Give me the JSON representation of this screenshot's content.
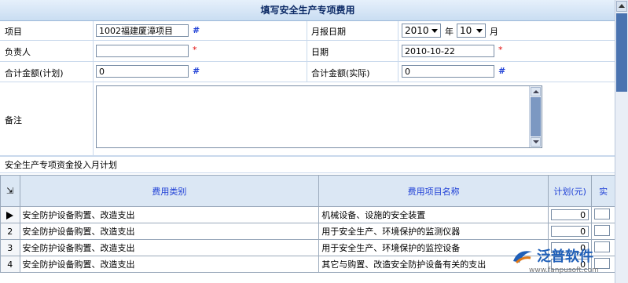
{
  "form": {
    "title": "填写安全生产专项费用",
    "project_label": "项目",
    "project_value": "1002福建厦漳项目",
    "month_label": "月报日期",
    "year_value": "2010",
    "year_unit": "年",
    "month_value": "10",
    "month_unit": "月",
    "owner_label": "负责人",
    "owner_value": "",
    "date_label": "日期",
    "date_value": "2010-10-22",
    "plan_total_label": "合计金额(计划)",
    "plan_total_value": "0",
    "actual_total_label": "合计金额(实际)",
    "actual_total_value": "0",
    "note_label": "备注",
    "note_value": "",
    "hash_mark": "#",
    "required_mark": "*"
  },
  "section": {
    "title": "安全生产专项资金投入月计划"
  },
  "grid": {
    "headers": [
      "费用类别",
      "费用项目名称",
      "计划(元)",
      "实"
    ],
    "rows": [
      {
        "num": "",
        "category": "安全防护设备购置、改造支出",
        "item": "机械设备、设施的安全装置",
        "plan": "0"
      },
      {
        "num": "2",
        "category": "安全防护设备购置、改造支出",
        "item": "用于安全生产、环境保护的监测仪器",
        "plan": "0"
      },
      {
        "num": "3",
        "category": "安全防护设备购置、改造支出",
        "item": "用于安全生产、环境保护的监控设备",
        "plan": "0"
      },
      {
        "num": "4",
        "category": "安全防护设备购置、改造支出",
        "item": "其它与购置、改造安全防护设备有关的支出",
        "plan": "0"
      }
    ]
  },
  "watermark": {
    "brand": "泛普软件",
    "url": "www.fanpusoft.com"
  },
  "colors": {
    "accent": "#1e3fd6",
    "required": "#e01010",
    "header_bg": "#dbe7f4"
  }
}
